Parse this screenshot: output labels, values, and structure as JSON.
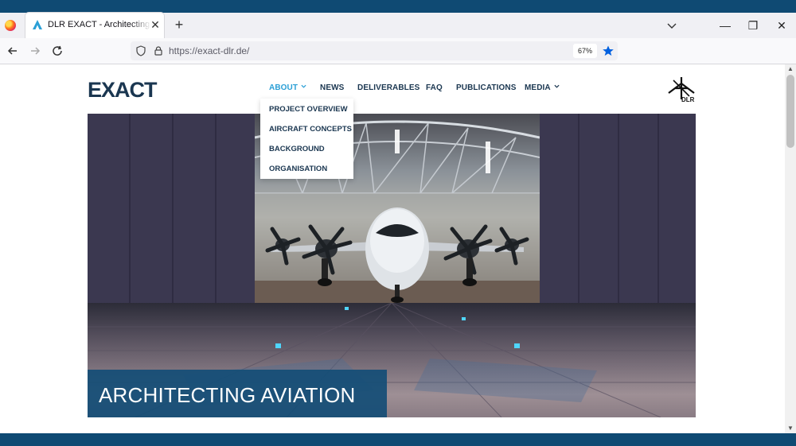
{
  "browser": {
    "tab_title": "DLR EXACT - Architecting Aviation",
    "tab_close": "✕",
    "new_tab": "+",
    "url": "https://exact-dlr.de/",
    "zoom": "67%",
    "window_controls": {
      "minimize": "—",
      "restore": "❐",
      "close": "✕"
    }
  },
  "site": {
    "logo_text": "EXACT",
    "nav": [
      {
        "label": "ABOUT",
        "has_dropdown": true,
        "active": true
      },
      {
        "label": "NEWS"
      },
      {
        "label": "DELIVERABLES"
      },
      {
        "label": "FAQ"
      },
      {
        "label": "PUBLICATIONS"
      },
      {
        "label": "MEDIA",
        "has_dropdown": true
      }
    ],
    "about_menu": [
      "PROJECT OVERVIEW",
      "AIRCRAFT CONCEPTS",
      "BACKGROUND",
      "ORGANISATION"
    ],
    "dlr_logo_text": "DLR",
    "hero_caption": "ARCHITECTING AVIATION"
  },
  "colors": {
    "brand_dark": "#0f4a73",
    "nav_text": "#1a3650",
    "accent": "#2a9fd6",
    "caption_bg": "#144d76"
  },
  "scrollbar": {
    "up": "▲",
    "down": "▼"
  }
}
